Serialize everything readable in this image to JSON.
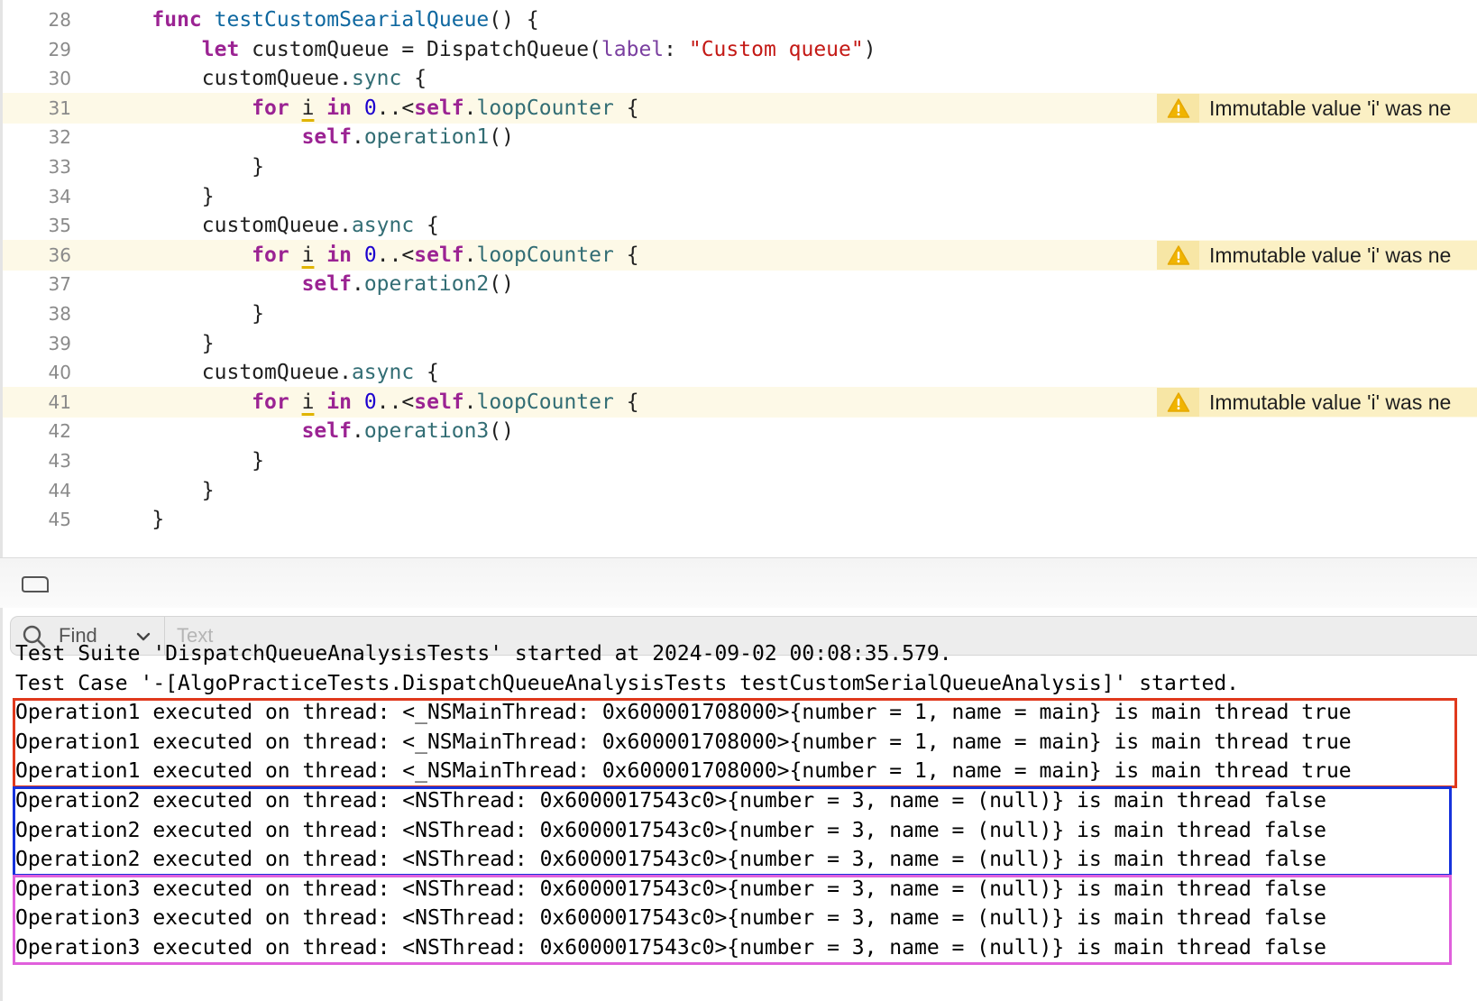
{
  "editor": {
    "lines": [
      {
        "num": "28",
        "html": "    <span class=\"kw\">func</span> <span class=\"fn\">testCustomSearialQueue</span>() {"
      },
      {
        "num": "29",
        "html": "        <span class=\"kw\">let</span> customQueue = DispatchQueue(<span class=\"lbl\">label</span>: <span class=\"str\">\"Custom queue\"</span>)"
      },
      {
        "num": "30",
        "html": "        customQueue.<span class=\"mem\">sync</span> {"
      },
      {
        "num": "31",
        "html": "            <span class=\"kw\">for</span> <span class=\"ivar\">i</span> <span class=\"kw\">in</span> <span class=\"num\">0</span>..&lt;<span class=\"kw\">self</span>.<span class=\"mem\">loopCounter</span> {",
        "warning": "Immutable value 'i' was ne"
      },
      {
        "num": "32",
        "html": "                <span class=\"kw\">self</span>.<span class=\"mem\">operation1</span>()"
      },
      {
        "num": "33",
        "html": "            }"
      },
      {
        "num": "34",
        "html": "        }"
      },
      {
        "num": "35",
        "html": "        customQueue.<span class=\"mem\">async</span> {"
      },
      {
        "num": "36",
        "html": "            <span class=\"kw\">for</span> <span class=\"ivar\">i</span> <span class=\"kw\">in</span> <span class=\"num\">0</span>..&lt;<span class=\"kw\">self</span>.<span class=\"mem\">loopCounter</span> {",
        "warning": "Immutable value 'i' was ne"
      },
      {
        "num": "37",
        "html": "                <span class=\"kw\">self</span>.<span class=\"mem\">operation2</span>()"
      },
      {
        "num": "38",
        "html": "            }"
      },
      {
        "num": "39",
        "html": "        }"
      },
      {
        "num": "40",
        "html": "        customQueue.<span class=\"mem\">async</span> {"
      },
      {
        "num": "41",
        "html": "            <span class=\"kw\">for</span> <span class=\"ivar\">i</span> <span class=\"kw\">in</span> <span class=\"num\">0</span>..&lt;<span class=\"kw\">self</span>.<span class=\"mem\">loopCounter</span> {",
        "warning": "Immutable value 'i' was ne"
      },
      {
        "num": "42",
        "html": "                <span class=\"kw\">self</span>.<span class=\"mem\">operation3</span>()"
      },
      {
        "num": "43",
        "html": "            }"
      },
      {
        "num": "44",
        "html": "        }"
      },
      {
        "num": "45",
        "html": "    }"
      }
    ]
  },
  "console": {
    "find_label": "Find",
    "filter_placeholder": "Text",
    "lines": [
      "Test Suite 'DispatchQueueAnalysisTests' started at 2024-09-02 00:08:35.579.",
      "Test Case '-[AlgoPracticeTests.DispatchQueueAnalysisTests testCustomSerialQueueAnalysis]' started.",
      "Operation1 executed on thread: <_NSMainThread: 0x600001708000>{number = 1, name = main} is main thread true",
      "Operation1 executed on thread: <_NSMainThread: 0x600001708000>{number = 1, name = main} is main thread true",
      "Operation1 executed on thread: <_NSMainThread: 0x600001708000>{number = 1, name = main} is main thread true",
      "Operation2 executed on thread: <NSThread: 0x6000017543c0>{number = 3, name = (null)} is main thread false",
      "Operation2 executed on thread: <NSThread: 0x6000017543c0>{number = 3, name = (null)} is main thread false",
      "Operation2 executed on thread: <NSThread: 0x6000017543c0>{number = 3, name = (null)} is main thread false",
      "Operation3 executed on thread: <NSThread: 0x6000017543c0>{number = 3, name = (null)} is main thread false",
      "Operation3 executed on thread: <NSThread: 0x6000017543c0>{number = 3, name = (null)} is main thread false",
      "Operation3 executed on thread: <NSThread: 0x6000017543c0>{number = 3, name = (null)} is main thread false"
    ],
    "highlight_colors": {
      "operation1": "#e0391d",
      "operation2": "#1733dc",
      "operation3": "#e060dc"
    }
  },
  "icons": {
    "warning": "warning-triangle-icon",
    "search": "search-icon",
    "chevron": "chevron-down-icon",
    "minimap": "minimap-toggle-icon"
  }
}
